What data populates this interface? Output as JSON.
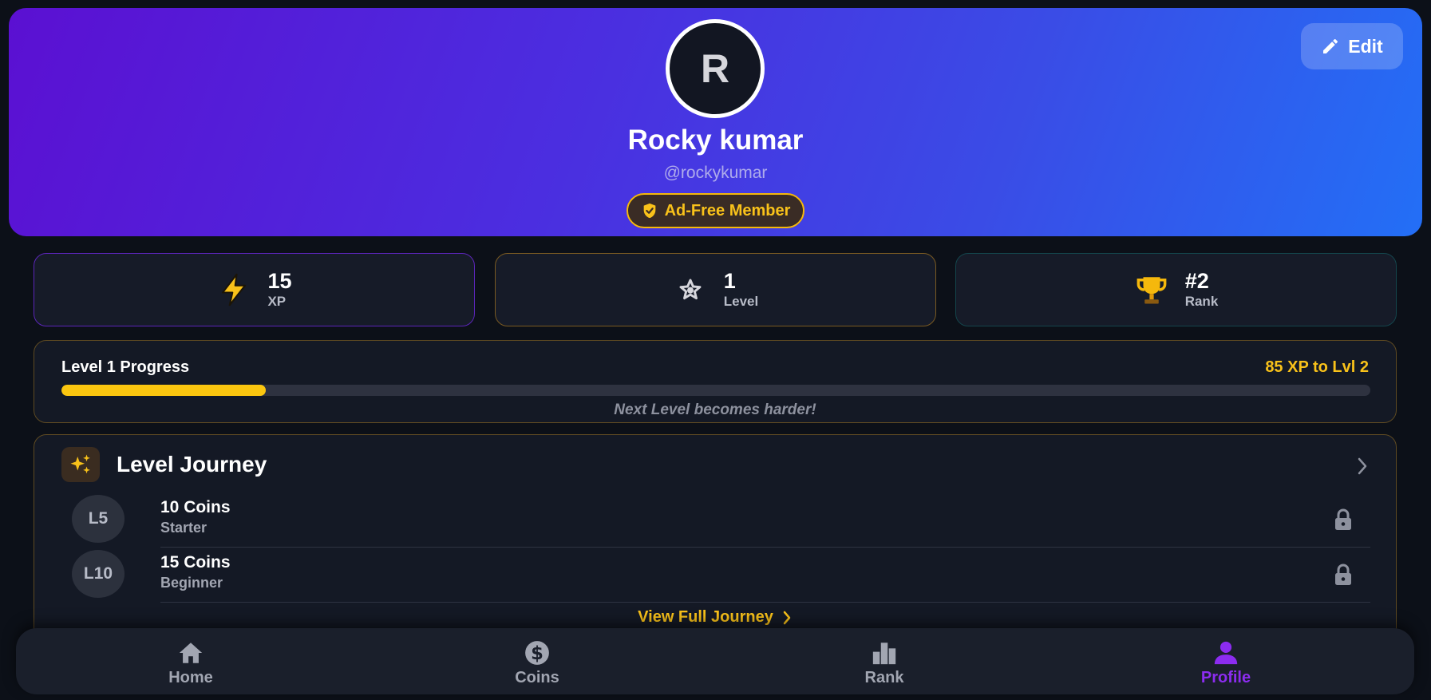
{
  "profile": {
    "avatar_initial": "R",
    "name": "Rocky kumar",
    "handle": "@rockykumar",
    "badge": "Ad-Free Member",
    "edit_label": "Edit"
  },
  "stats": [
    {
      "value": "15",
      "label": "XP",
      "icon": "lightning-icon",
      "color": "#f9c21a"
    },
    {
      "value": "1",
      "label": "Level",
      "icon": "star-icon",
      "color": "#d6d6dc"
    },
    {
      "value": "#2",
      "label": "Rank",
      "icon": "trophy-icon",
      "color": "#f5b80c"
    }
  ],
  "progress": {
    "title": "Level 1 Progress",
    "remaining": "85 XP to Lvl 2",
    "fraction": 0.156,
    "note": "Next Level becomes harder!"
  },
  "journey": {
    "title": "Level Journey",
    "rows": [
      {
        "level": "L5",
        "reward": "10 Coins",
        "tier": "Starter",
        "locked": true
      },
      {
        "level": "L10",
        "reward": "15 Coins",
        "tier": "Beginner",
        "locked": true
      }
    ],
    "view_full": "View Full Journey"
  },
  "nav": [
    {
      "label": "Home",
      "icon": "home-icon",
      "active": false
    },
    {
      "label": "Coins",
      "icon": "coins-icon",
      "active": false
    },
    {
      "label": "Rank",
      "icon": "rank-icon",
      "active": false
    },
    {
      "label": "Profile",
      "icon": "profile-icon",
      "active": true
    }
  ],
  "colors": {
    "accent_gold": "#f9c21a",
    "active_purple": "#8c2cf0",
    "background": "#0c1018"
  }
}
